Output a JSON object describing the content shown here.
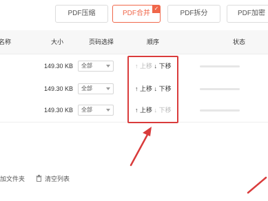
{
  "toolbar": {
    "tabs": [
      {
        "label": "PDF压缩"
      },
      {
        "label": "PDF合并",
        "check": "✓"
      },
      {
        "label": "PDF拆分"
      },
      {
        "label": "PDF加密"
      }
    ]
  },
  "table": {
    "headers": {
      "name": "名称",
      "size": "大小",
      "pages": "页码选择",
      "order": "顺序",
      "status": "状态"
    },
    "rows": [
      {
        "size": "149.30 KB",
        "pages": "全部",
        "up": "上移",
        "down": "下移",
        "up_enabled": false,
        "down_enabled": true,
        "progress": 0
      },
      {
        "size": "149.30 KB",
        "pages": "全部",
        "up": "上移",
        "down": "下移",
        "up_enabled": true,
        "down_enabled": true,
        "progress": 0
      },
      {
        "size": "149.30 KB",
        "pages": "全部",
        "up": "上移",
        "down": "下移",
        "up_enabled": true,
        "down_enabled": false,
        "progress": 0
      }
    ]
  },
  "footer": {
    "add_folder": "加文件夹",
    "clear_list": "清空列表"
  },
  "colors": {
    "accent": "#f0674a",
    "annotation": "#d93b3b"
  }
}
